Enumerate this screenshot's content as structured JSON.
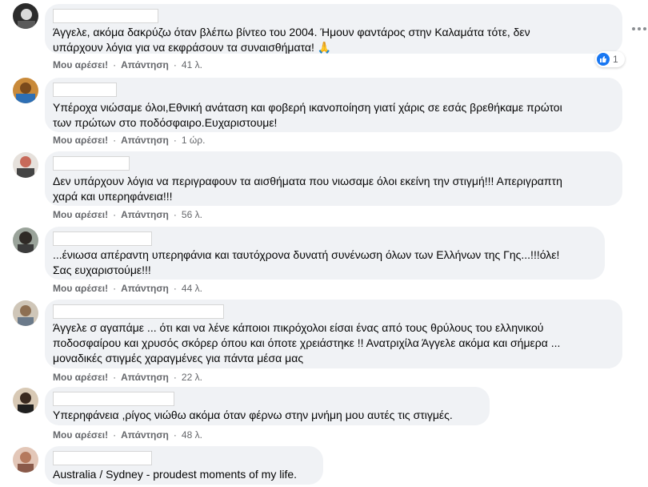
{
  "comments": [
    {
      "text": "Άγγελε, ακόμα δακρύζω όταν βλέπω βίντεο του 2004. Ήμουν φαντάρος στην Καλαμάτα τότε, δεν\nυπάρχουν λόγια για να εκφράσουν τα συναισθήματα! 🙏",
      "like": "Μου αρέσει!",
      "reply": "Απάντηση",
      "time": "41 λ.",
      "reaction_count": "1"
    },
    {
      "text": "Υπέροχα νιώσαμε όλοι,Εθνική ανάταση και φοβερή ικανοποίηση γιατί χάρις σε εσάς βρεθήκαμε πρώτοι\nτων πρώτων στο ποδόσφαιρο.Ευχαριστουμε!",
      "like": "Μου αρέσει!",
      "reply": "Απάντηση",
      "time": "1 ώρ."
    },
    {
      "text": "Δεν υπάρχουν λόγια να περιγραφουν τα αισθήματα που νιωσαμε όλοι εκείνη την στιγμή!!! Απεριγραπτη\nχαρά και υπερηφάνεια!!!",
      "like": "Μου αρέσει!",
      "reply": "Απάντηση",
      "time": "56 λ."
    },
    {
      "text": "...ένιωσα απέραντη υπερηφάνια και ταυτόχρονα δυνατή συνένωση όλων των Ελλήνων της Γης...!!!όλε!\nΣας ευχαριστούμε!!!",
      "like": "Μου αρέσει!",
      "reply": "Απάντηση",
      "time": "44 λ."
    },
    {
      "text": "Άγγελε σ αγαπάμε ... ότι και να λένε κάποιοι πικρόχολοι είσαι ένας από τους θρύλους του ελληνικού\nποδοσφαίρου και χρυσός σκόρερ όπου και όποτε χρειάστηκε !! Ανατριχίλα Άγγελε ακόμα και σήμερα ...\nμοναδικές στιγμές χαραγμένες για πάντα μέσα μας",
      "like": "Μου αρέσει!",
      "reply": "Απάντηση",
      "time": "22 λ."
    },
    {
      "text": "Υπερηφάνεια ,ρίγος νιώθω ακόμα όταν φέρνω στην μνήμη μου αυτές τις στιγμές.",
      "like": "Μου αρέσει!",
      "reply": "Απάντηση",
      "time": "48 λ."
    },
    {
      "text": "Australia / Sydney - proudest moments of my life.",
      "like": "",
      "reply": "",
      "time": ""
    }
  ],
  "colors": {
    "bubble": "#f0f2f5",
    "meta": "#65676b",
    "like_blue": "#1877f2"
  }
}
